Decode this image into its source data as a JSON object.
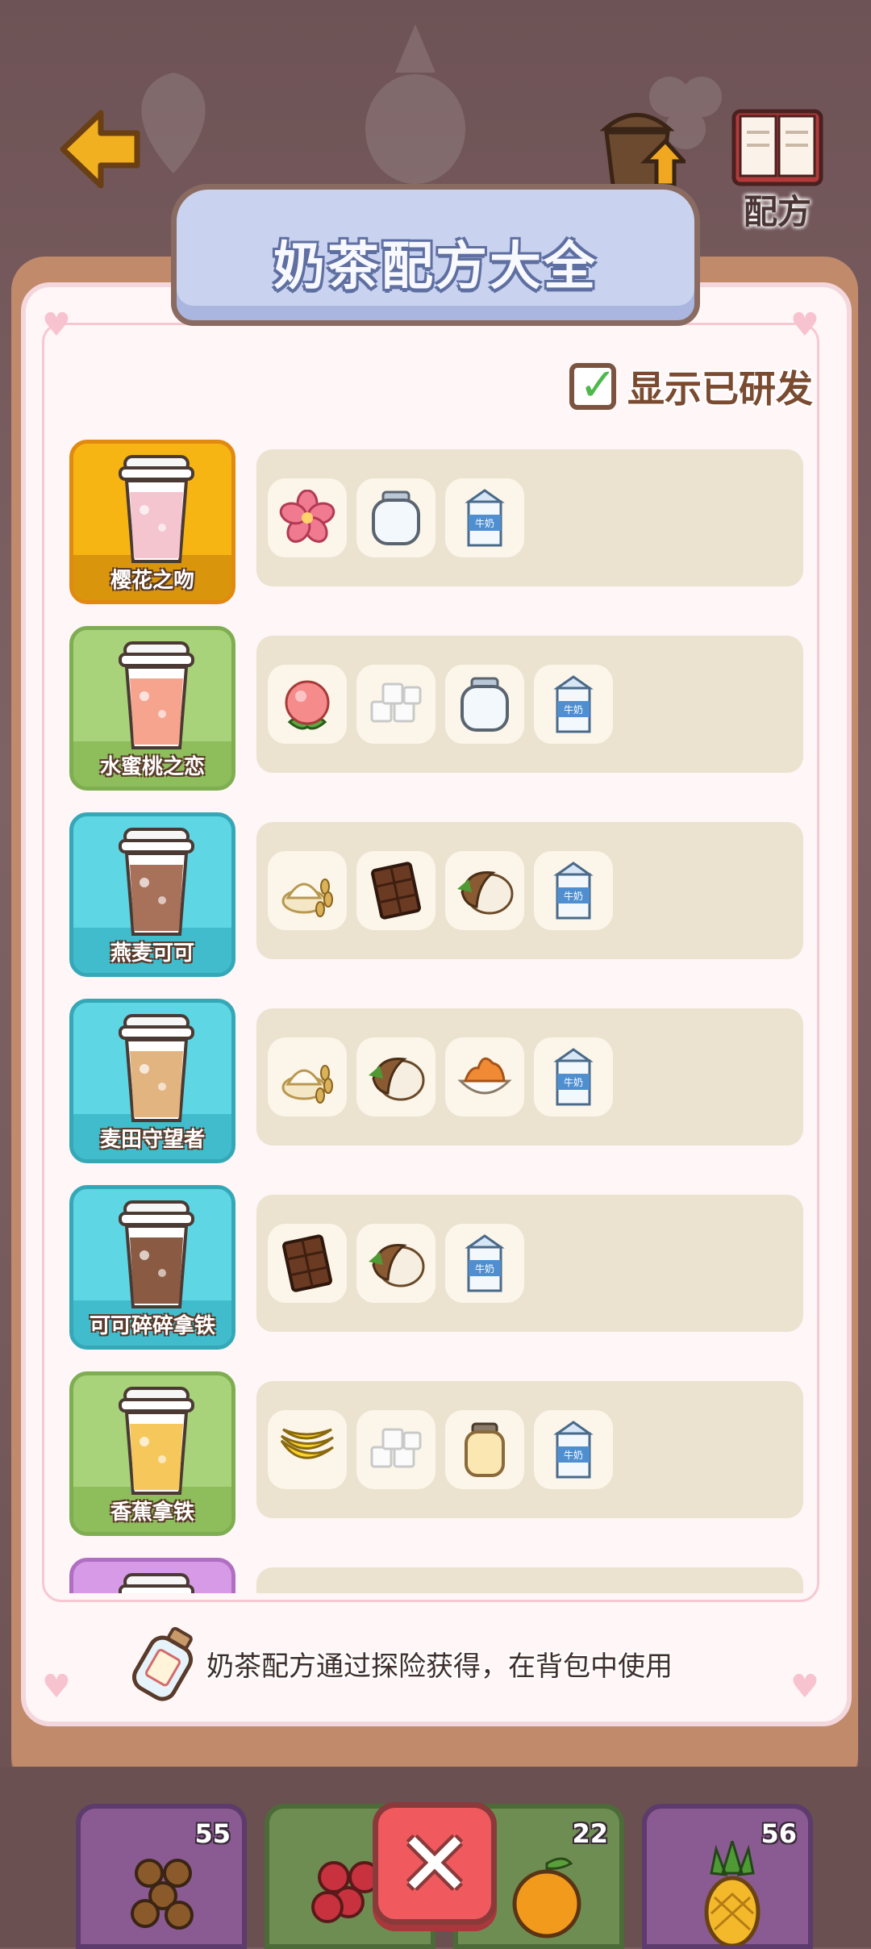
{
  "header": {
    "title": "奶茶配方大全",
    "top_icons": [
      {
        "name": "upgrade",
        "label": "升级"
      },
      {
        "name": "recipe",
        "label": "配方"
      }
    ]
  },
  "toggle": {
    "label": "显示已研发",
    "checked": true
  },
  "recipes": [
    {
      "name": "樱花之吻",
      "bg": "#f7b514",
      "strip": "#d9950c",
      "border": "#e08a10",
      "cup_color": "#f4c4cf",
      "ingredients": [
        "sakura-flower",
        "glass-jar",
        "milk-carton"
      ]
    },
    {
      "name": "水蜜桃之恋",
      "bg": "#a9d37a",
      "strip": "#8ebd5c",
      "border": "#7fae52",
      "cup_color": "#f6a48e",
      "ingredients": [
        "peach",
        "sugar-cubes",
        "glass-jar",
        "milk-carton"
      ]
    },
    {
      "name": "燕麦可可",
      "bg": "#5fd6e4",
      "strip": "#41bccc",
      "border": "#35a8b8",
      "cup_color": "#a8715a",
      "ingredients": [
        "oat-flour",
        "chocolate-bar",
        "coconut",
        "milk-carton"
      ]
    },
    {
      "name": "麦田守望者",
      "bg": "#5fd6e4",
      "strip": "#41bccc",
      "border": "#35a8b8",
      "cup_color": "#e2b580",
      "ingredients": [
        "oat-flour",
        "coconut",
        "caramel-cream",
        "milk-carton"
      ]
    },
    {
      "name": "可可碎碎拿铁",
      "bg": "#5fd6e4",
      "strip": "#41bccc",
      "border": "#35a8b8",
      "cup_color": "#8a5a43",
      "ingredients": [
        "chocolate-bar",
        "coconut",
        "milk-carton"
      ]
    },
    {
      "name": "香蕉拿铁",
      "bg": "#a9d37a",
      "strip": "#8ebd5c",
      "border": "#7fae52",
      "cup_color": "#f6c75a",
      "ingredients": [
        "banana",
        "sugar-cubes",
        "honey-jar",
        "milk-carton"
      ]
    },
    {
      "name": "",
      "bg": "#d79ae6",
      "strip": "#c07ed0",
      "border": "#b06fc2",
      "cup_color": "#9ad27f",
      "ingredients": []
    }
  ],
  "hint": {
    "text": "奶茶配方通过探险获得，在背包中使用"
  },
  "tray": [
    {
      "name": "tapioca-pearls",
      "count": "55",
      "bg": "#8a5b92"
    },
    {
      "name": "grapes",
      "count": "",
      "bg": "#6e8d52"
    },
    {
      "name": "orange",
      "count": "22",
      "bg": "#6e8d52"
    },
    {
      "name": "pineapple",
      "count": "56",
      "bg": "#8a5b92"
    }
  ],
  "milk_label": "牛奶"
}
